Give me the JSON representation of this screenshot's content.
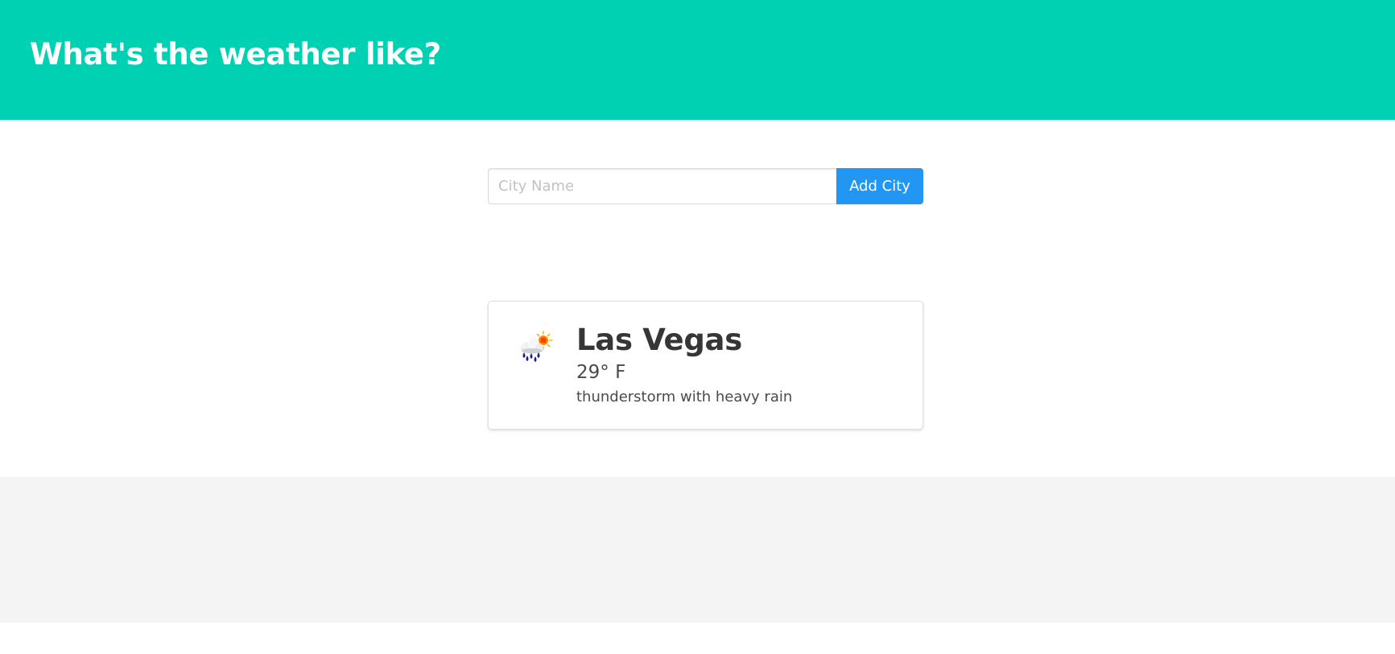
{
  "header": {
    "title": "What's the weather like?"
  },
  "search": {
    "placeholder": "City Name",
    "value": "",
    "button_label": "Add City"
  },
  "weather_cards": [
    {
      "city": "Las Vegas",
      "temperature": "29° F",
      "description": "thunderstorm with heavy rain",
      "icon": "thunderstorm-rain-sun-icon"
    }
  ],
  "colors": {
    "header_bg": "#00d1b2",
    "button_bg": "#2196f3",
    "footer_bg": "#f4f4f4"
  }
}
